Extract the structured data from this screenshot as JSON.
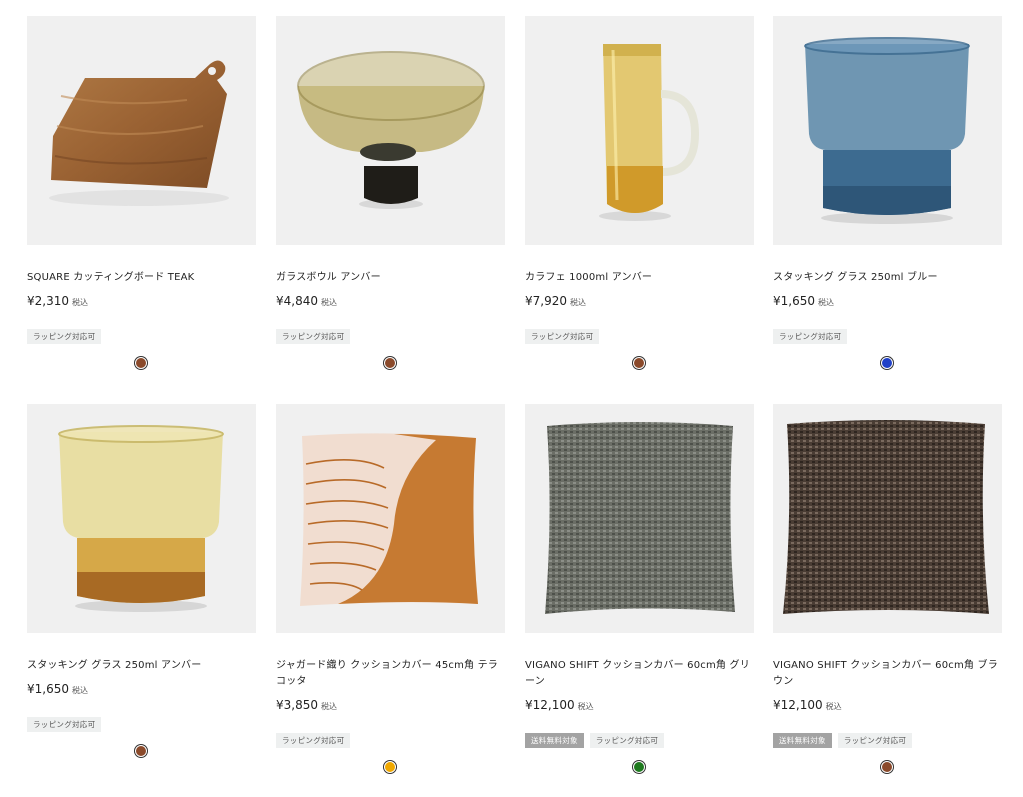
{
  "products": [
    {
      "name": "SQUARE カッティングボード TEAK",
      "price": "¥2,310",
      "tax": "税込",
      "badges": [
        "ラッピング対応可"
      ],
      "swatch": "#8b4a2b",
      "image": "cutting-board"
    },
    {
      "name": "ガラスボウル アンバー",
      "price": "¥4,840",
      "tax": "税込",
      "badges": [
        "ラッピング対応可"
      ],
      "swatch": "#8b4a2b",
      "image": "glass-bowl"
    },
    {
      "name": "カラフェ 1000ml アンバー",
      "price": "¥7,920",
      "tax": "税込",
      "badges": [
        "ラッピング対応可"
      ],
      "swatch": "#8b4a2b",
      "image": "carafe"
    },
    {
      "name": "スタッキング グラス 250ml ブルー",
      "price": "¥1,650",
      "tax": "税込",
      "badges": [
        "ラッピング対応可"
      ],
      "swatch": "#2040c8",
      "image": "stacking-glass-blue"
    },
    {
      "name": "スタッキング グラス 250ml アンバー",
      "price": "¥1,650",
      "tax": "税込",
      "badges": [
        "ラッピング対応可"
      ],
      "swatch": "#8b4a2b",
      "image": "stacking-glass-amber"
    },
    {
      "name": "ジャガード織り クッションカバー 45cm角 テラコッタ",
      "price": "¥3,850",
      "tax": "税込",
      "badges": [
        "ラッピング対応可"
      ],
      "swatch": "#f0a800",
      "image": "cushion-terracotta"
    },
    {
      "name": "VIGANO SHIFT クッションカバー 60cm角 グリーン",
      "price": "¥12,100",
      "tax": "税込",
      "badges": [
        "送料無料対象",
        "ラッピング対応可"
      ],
      "swatch": "#1f7a1f",
      "image": "cushion-green"
    },
    {
      "name": "VIGANO SHIFT クッションカバー 60cm角 ブラウン",
      "price": "¥12,100",
      "tax": "税込",
      "badges": [
        "送料無料対象",
        "ラッピング対応可"
      ],
      "swatch": "#8b4a2b",
      "image": "cushion-brown"
    }
  ],
  "badge_styles": {
    "送料無料対象": "dark",
    "ラッピング対応可": "light"
  }
}
